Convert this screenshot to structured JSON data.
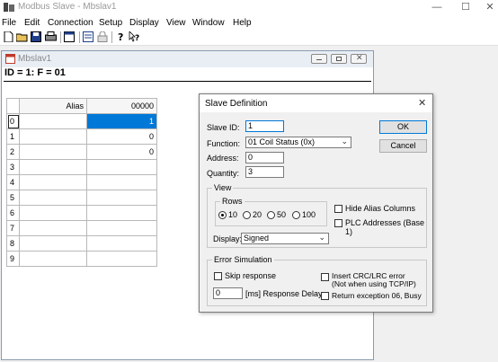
{
  "app": {
    "title": "Modbus Slave - Mbslav1",
    "window_controls": {
      "minimize": "—",
      "maximize": "☐",
      "close": "✕"
    }
  },
  "menu": [
    "File",
    "Edit",
    "Connection",
    "Setup",
    "Display",
    "View",
    "Window",
    "Help"
  ],
  "toolbar": {
    "icons": [
      "new-icon",
      "open-icon",
      "save-icon",
      "print-icon",
      "window-icon",
      "slave-definition-icon",
      "lock-icon",
      "help-icon",
      "context-help-icon"
    ]
  },
  "child": {
    "title": "Mbslav1",
    "header": "ID = 1: F = 01",
    "grid": {
      "col_headers": [
        "Alias",
        "00000"
      ],
      "rows": [
        {
          "n": "0",
          "alias": "",
          "value": "1"
        },
        {
          "n": "1",
          "alias": "",
          "value": "0"
        },
        {
          "n": "2",
          "alias": "",
          "value": "0"
        },
        {
          "n": "3",
          "alias": "",
          "value": ""
        },
        {
          "n": "4",
          "alias": "",
          "value": ""
        },
        {
          "n": "5",
          "alias": "",
          "value": ""
        },
        {
          "n": "6",
          "alias": "",
          "value": ""
        },
        {
          "n": "7",
          "alias": "",
          "value": ""
        },
        {
          "n": "8",
          "alias": "",
          "value": ""
        },
        {
          "n": "9",
          "alias": "",
          "value": ""
        }
      ]
    }
  },
  "dialog": {
    "title": "Slave Definition",
    "close": "✕",
    "slave_id_label": "Slave ID:",
    "slave_id": "1",
    "function_label": "Function:",
    "function_value": "01 Coil Status (0x)",
    "address_label": "Address:",
    "address": "0",
    "quantity_label": "Quantity:",
    "quantity": "3",
    "ok": "OK",
    "cancel": "Cancel",
    "view_group": "View",
    "rows_group": "Rows",
    "rows_options": [
      "10",
      "20",
      "50",
      "100"
    ],
    "rows_selected": "10",
    "hide_alias_label": "Hide Alias Columns",
    "plc_addresses_label": "PLC Addresses (Base 1)",
    "display_label": "Display:",
    "display_value": "Signed",
    "error_group": "Error Simulation",
    "skip_response_label": "Skip response",
    "insert_crc_label": "Insert CRC/LRC error",
    "insert_crc_note": "(Not when using TCP/IP)",
    "response_delay_value": "0",
    "response_delay_label": "[ms] Response Delay",
    "return_exception_label": "Return exception 06, Busy"
  },
  "colors": {
    "selection": "#0078d7",
    "window_bg": "#f0f0f0"
  }
}
